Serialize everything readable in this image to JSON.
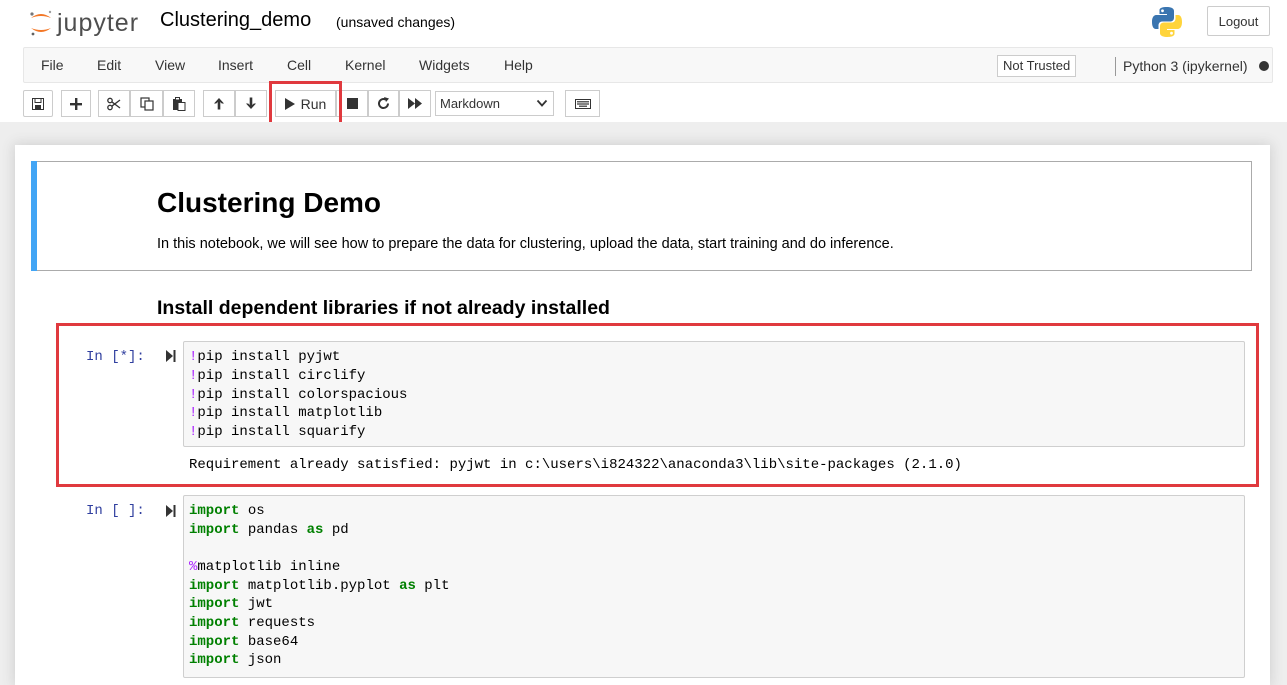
{
  "header": {
    "logo_text": "jupyter",
    "notebook_name": "Clustering_demo",
    "save_status": "(unsaved changes)",
    "logout_label": "Logout"
  },
  "menubar": {
    "items": [
      "File",
      "Edit",
      "View",
      "Insert",
      "Cell",
      "Kernel",
      "Widgets",
      "Help"
    ],
    "trust_label": "Not Trusted",
    "kernel_name": "Python 3 (ipykernel)"
  },
  "toolbar": {
    "run_label": "Run",
    "cell_type": "Markdown",
    "icons": [
      "save-icon",
      "plus-icon",
      "cut-icon",
      "copy-icon",
      "paste-icon",
      "arrow-up-icon",
      "arrow-down-icon",
      "play-icon",
      "stop-icon",
      "restart-icon",
      "fast-forward-icon",
      "keyboard-icon"
    ]
  },
  "cells": {
    "markdown": {
      "title": "Clustering Demo",
      "paragraph": "In this notebook, we will see how to prepare the data for clustering, upload the data, start training and do inference."
    },
    "heading2": "Install dependent libraries if not already installed",
    "cell1": {
      "prompt": "In [*]:",
      "lines": [
        {
          "bang": "!",
          "rest": "pip install pyjwt"
        },
        {
          "bang": "!",
          "rest": "pip install circlify"
        },
        {
          "bang": "!",
          "rest": "pip install colorspacious"
        },
        {
          "bang": "!",
          "rest": "pip install matplotlib"
        },
        {
          "bang": "!",
          "rest": "pip install squarify"
        }
      ],
      "output": "Requirement already satisfied: pyjwt in c:\\users\\i824322\\anaconda3\\lib\\site-packages (2.1.0)"
    },
    "cell2": {
      "prompt": "In [ ]:",
      "l1_kw": "import",
      "l1_rest": " os",
      "l2_kw": "import",
      "l2_mid": " pandas ",
      "l2_kw2": "as",
      "l2_rest": " pd",
      "l4_magic": "%",
      "l4_rest": "matplotlib inline",
      "l5_kw": "import",
      "l5_mid": " matplotlib.pyplot ",
      "l5_kw2": "as",
      "l5_rest": " plt",
      "l6_kw": "import",
      "l6_rest": " jwt",
      "l7_kw": "import",
      "l7_rest": " requests",
      "l8_kw": "import",
      "l8_rest": " base64",
      "l9_kw": "import",
      "l9_rest": " json"
    }
  },
  "colors": {
    "accent_selected": "#42a5f5",
    "highlight": "#e0393e",
    "prompt": "#303f9f",
    "keyword": "#008000",
    "magic": "#aa22ff"
  }
}
